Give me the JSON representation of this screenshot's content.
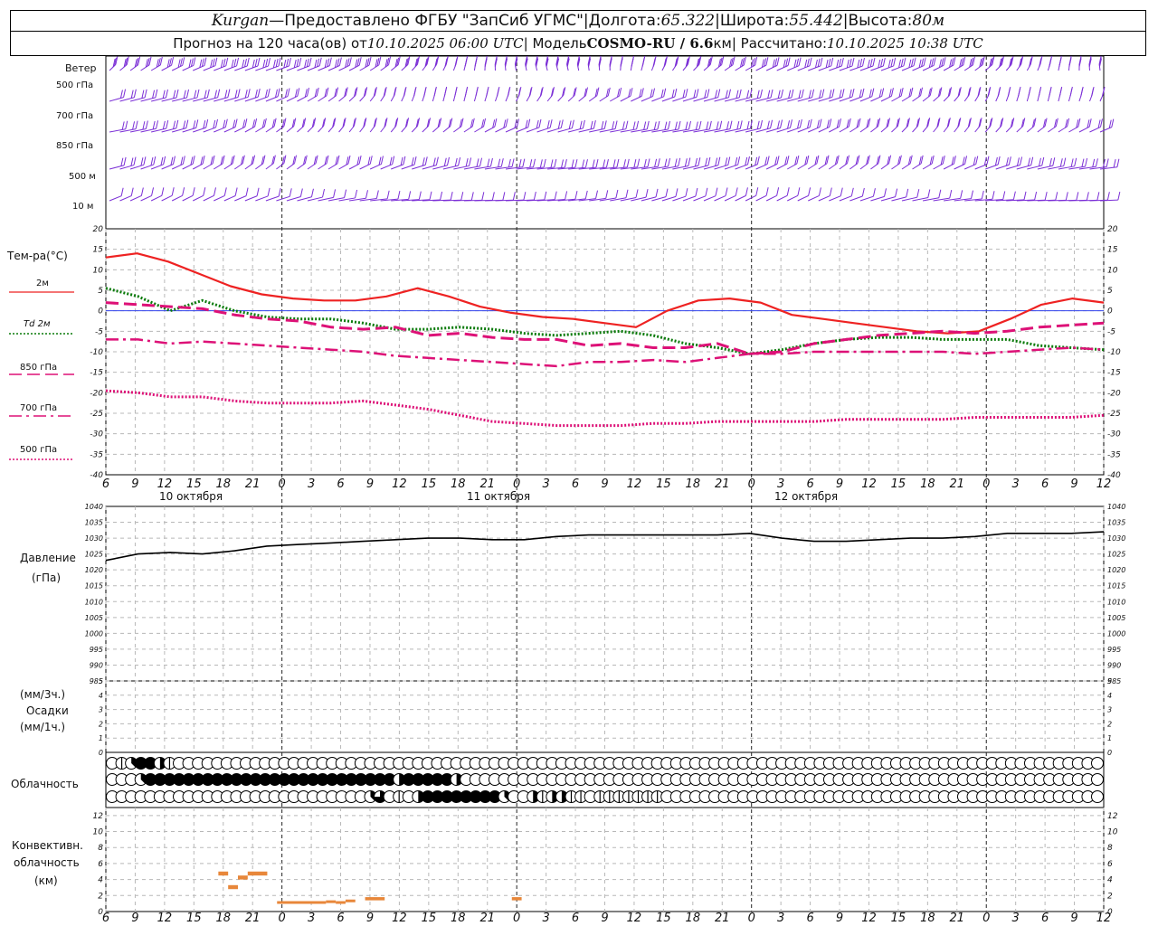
{
  "header": {
    "station": "Kurgan",
    "dash": " — ",
    "provider": "Предоставлено ФГБУ \"ЗапСиб УГМС\"",
    "sep": " | ",
    "lon_label": "Долгота: ",
    "lon_value": "65.322",
    "lat_label": "Широта: ",
    "lat_value": "55.442",
    "alt_label": "Высота: ",
    "alt_value": "80м",
    "forecast_prefix": "Прогноз на 120 часа(ов) от ",
    "forecast_start": "10.10.2025 06:00 UTC",
    "model_label": "  | Модель ",
    "model_name": "COSMO-RU / 6.6",
    "model_unit": "км",
    "computed_label": " | Рассчитано: ",
    "computed_value": "10.10.2025 10:38 UTC"
  },
  "labels": {
    "wind": "Ветер",
    "wind_levels": [
      "500 гПа",
      "700 гПа",
      "850 гПа",
      "500 м",
      "10 м"
    ],
    "temp_title": "Тем-ра(°С)",
    "legend": [
      {
        "name": "2м",
        "color": "#ee2222",
        "style": "solid"
      },
      {
        "name": "Td 2м",
        "color": "#0a7a0a",
        "style": "dotted"
      },
      {
        "name": "850 гПа",
        "color": "#dd1177",
        "style": "dashed"
      },
      {
        "name": "700 гПа",
        "color": "#dd1177",
        "style": "dashdot"
      },
      {
        "name": "500 гПа",
        "color": "#dd1177",
        "style": "dotted"
      }
    ],
    "pressure_title": "Давление",
    "pressure_unit": "(гПа)",
    "precip_unit1": "(мм/3ч.)",
    "precip_title": "Осадки",
    "precip_unit2": "(мм/1ч.)",
    "cloud_title": "Облачность",
    "conv_line1": "Конвективн.",
    "conv_line2": "облачность",
    "conv_line3": "(км)",
    "dates": [
      "10 октября",
      "11 октября",
      "12 октября"
    ]
  },
  "colors": {
    "temp2m": "#ee2222",
    "dew": "#0a7a0a",
    "upper": "#dd1177",
    "wind": "#7b2fd6",
    "pressure": "#000000",
    "conv": "#e8873a"
  },
  "chart_data": [
    {
      "type": "line",
      "title": "Тем-ра(°С)",
      "x": [
        6,
        9,
        12,
        15,
        18,
        21,
        24,
        27,
        30,
        33,
        36,
        39,
        42,
        45,
        48,
        51,
        54,
        57,
        60,
        63,
        66,
        69,
        72,
        75,
        78,
        81,
        84,
        87,
        90,
        93,
        96,
        99,
        102,
        105,
        108
      ],
      "x_tick_labels": [
        "6",
        "9",
        "12",
        "15",
        "18",
        "21",
        "0",
        "3",
        "6",
        "9",
        "12",
        "15",
        "18",
        "21",
        "0",
        "3",
        "6",
        "9",
        "12",
        "15",
        "18",
        "21",
        "0",
        "3",
        "6",
        "9",
        "12",
        "15",
        "18",
        "21",
        "0",
        "3",
        "6",
        "9",
        "12"
      ],
      "ylim": [
        -40,
        20
      ],
      "series": [
        {
          "name": "2м",
          "values": [
            13,
            14,
            12,
            9,
            6,
            4,
            3,
            2.5,
            2.5,
            3.5,
            5.5,
            3.5,
            1,
            -0.5,
            -1.5,
            -2,
            -3,
            -4,
            0,
            2.5,
            3,
            2,
            -1,
            -2,
            -3,
            -4,
            -5,
            -5.5,
            -5,
            -2,
            1.5,
            3,
            2
          ]
        },
        {
          "name": "Td 2м",
          "values": [
            5.5,
            3.5,
            0,
            2.5,
            0,
            -1.5,
            -2,
            -2,
            -3,
            -4.5,
            -4.5,
            -4,
            -4.5,
            -5.5,
            -6,
            -5.5,
            -5,
            -6,
            -8,
            -9,
            -10.5,
            -9.5,
            -8,
            -7,
            -6.5,
            -6.5,
            -7,
            -7,
            -7,
            -8.5,
            -9,
            -9.5
          ]
        },
        {
          "name": "850 гПа",
          "values": [
            2,
            1.5,
            1,
            0.5,
            -1,
            -2,
            -2.5,
            -4,
            -4.5,
            -4,
            -6,
            -5.5,
            -6.5,
            -7,
            -7,
            -8.5,
            -8,
            -9,
            -9,
            -8,
            -10.5,
            -10,
            -8,
            -7,
            -6,
            -5.5,
            -5,
            -5.5,
            -5,
            -4,
            -3.5,
            -3
          ]
        },
        {
          "name": "700 гПа",
          "values": [
            -7,
            -7,
            -8,
            -7.5,
            -8,
            -8.5,
            -9,
            -9.5,
            -10,
            -11,
            -11.5,
            -12,
            -12.5,
            -13,
            -13.5,
            -12.5,
            -12.5,
            -12,
            -12.5,
            -11.5,
            -10.5,
            -10.5,
            -10,
            -10,
            -10,
            -10,
            -10,
            -10.5,
            -10,
            -9.5,
            -9,
            -9.5
          ]
        },
        {
          "name": "500 гПа",
          "values": [
            -19.5,
            -20,
            -21,
            -21,
            -22,
            -22.5,
            -22.5,
            -22.5,
            -22,
            -23,
            -24,
            -25.5,
            -27,
            -27.5,
            -28,
            -28,
            -28,
            -27.5,
            -27.5,
            -27,
            -27,
            -27,
            -27,
            -26.5,
            -26.5,
            -26.5,
            -26.5,
            -26,
            -26,
            -26,
            -26,
            -25.5
          ]
        }
      ]
    },
    {
      "type": "line",
      "title": "Давление",
      "ylabel": "(гПа)",
      "ylim": [
        985,
        1040
      ],
      "series": [
        {
          "name": "Давление",
          "values": [
            1023,
            1025,
            1025.5,
            1025,
            1026,
            1027.5,
            1028,
            1028.5,
            1029,
            1029.5,
            1030,
            1030,
            1029.5,
            1029.5,
            1030.5,
            1031,
            1031,
            1031,
            1031,
            1031,
            1031.5,
            1030,
            1029,
            1029,
            1029.5,
            1030,
            1030,
            1030.5,
            1031.5,
            1031.5,
            1031.5,
            1032
          ]
        }
      ]
    },
    {
      "type": "bar",
      "title": "Осадки",
      "ylim": [
        0,
        5
      ],
      "values": []
    },
    {
      "type": "table",
      "title": "Облачность",
      "rows_oktas": [
        [
          0,
          1,
          3,
          8,
          8,
          4,
          2,
          0,
          0,
          0,
          0,
          0,
          0,
          0,
          0,
          0,
          0,
          0,
          0,
          0,
          0,
          0,
          0,
          0,
          0,
          0,
          0,
          0,
          0,
          0,
          0,
          0,
          0,
          0,
          0,
          0,
          0,
          0,
          0,
          0,
          0,
          0,
          0,
          0,
          0,
          0,
          0,
          0,
          0,
          0,
          0,
          0,
          0,
          0,
          0,
          0,
          0,
          0,
          0,
          0,
          0,
          0,
          0,
          0,
          0,
          0,
          0,
          0,
          0,
          0,
          0,
          0,
          0,
          0,
          0,
          0,
          0,
          0,
          0,
          0,
          0,
          0,
          0,
          0,
          0,
          0,
          0,
          0,
          0,
          0,
          0,
          0,
          0,
          0,
          0,
          0,
          0,
          0,
          0,
          0,
          0,
          0,
          0,
          0,
          0,
          6,
          6,
          6,
          6,
          4,
          2
        ],
        [
          0,
          0,
          0,
          3,
          8,
          8,
          8,
          8,
          8,
          8,
          8,
          8,
          8,
          8,
          8,
          8,
          8,
          8,
          8,
          8,
          8,
          8,
          8,
          8,
          8,
          8,
          8,
          8,
          8,
          8,
          4,
          8,
          8,
          8,
          8,
          8,
          4,
          0,
          0,
          0,
          0,
          0,
          0,
          0,
          0,
          0,
          0,
          0,
          0,
          0,
          0,
          0,
          0,
          0,
          0,
          0,
          0,
          0,
          0,
          0,
          0,
          0,
          0,
          0,
          0,
          0,
          0,
          0,
          0,
          0,
          0,
          0,
          0,
          0,
          0,
          0,
          0,
          0,
          0,
          0,
          0,
          0,
          0,
          0,
          0,
          0,
          0,
          0,
          0,
          0,
          0,
          0,
          0,
          0,
          0,
          0,
          0,
          0,
          0,
          0,
          0,
          0,
          0,
          0,
          0,
          6,
          0,
          8,
          8,
          8,
          3,
          8
        ],
        [
          0,
          0,
          0,
          0,
          0,
          0,
          0,
          0,
          0,
          0,
          0,
          0,
          0,
          0,
          0,
          0,
          0,
          0,
          0,
          0,
          0,
          0,
          0,
          0,
          0,
          0,
          0,
          3,
          6,
          0,
          2,
          0,
          4,
          8,
          8,
          8,
          8,
          8,
          8,
          8,
          8,
          3,
          0,
          0,
          4,
          2,
          4,
          4,
          2,
          2,
          0,
          1,
          1,
          1,
          2,
          1,
          1,
          1,
          0,
          0,
          0,
          0,
          0,
          0,
          0,
          0,
          0,
          0,
          0,
          0,
          0,
          0,
          0,
          0,
          0,
          0,
          0,
          0,
          0,
          0,
          0,
          0,
          0,
          0,
          0,
          0,
          0,
          0,
          0,
          0,
          0,
          0,
          0,
          0,
          0,
          0,
          0,
          0,
          0,
          0,
          0,
          0,
          0,
          0,
          0,
          0,
          0,
          0,
          0,
          0,
          0,
          0,
          0
        ]
      ]
    },
    {
      "type": "bar",
      "title": "Конвективн. облачность",
      "ylim": [
        0,
        13
      ],
      "segments": [
        {
          "start": 17.5,
          "end": 18.5,
          "base": 4.5,
          "top": 5
        },
        {
          "start": 18.5,
          "end": 19.5,
          "base": 2.8,
          "top": 3.3
        },
        {
          "start": 19.5,
          "end": 20.5,
          "base": 4,
          "top": 4.5
        },
        {
          "start": 20.5,
          "end": 22.5,
          "base": 4.5,
          "top": 5
        },
        {
          "start": 23.5,
          "end": 28.5,
          "base": 1,
          "top": 1.3
        },
        {
          "start": 28.5,
          "end": 29.5,
          "base": 1.1,
          "top": 1.4
        },
        {
          "start": 29.5,
          "end": 30.5,
          "base": 1,
          "top": 1.3
        },
        {
          "start": 30.5,
          "end": 31.5,
          "base": 1.2,
          "top": 1.5
        },
        {
          "start": 32.5,
          "end": 34.5,
          "base": 1.4,
          "top": 1.8
        },
        {
          "start": 47.5,
          "end": 48.5,
          "base": 1.4,
          "top": 1.8
        }
      ]
    }
  ]
}
